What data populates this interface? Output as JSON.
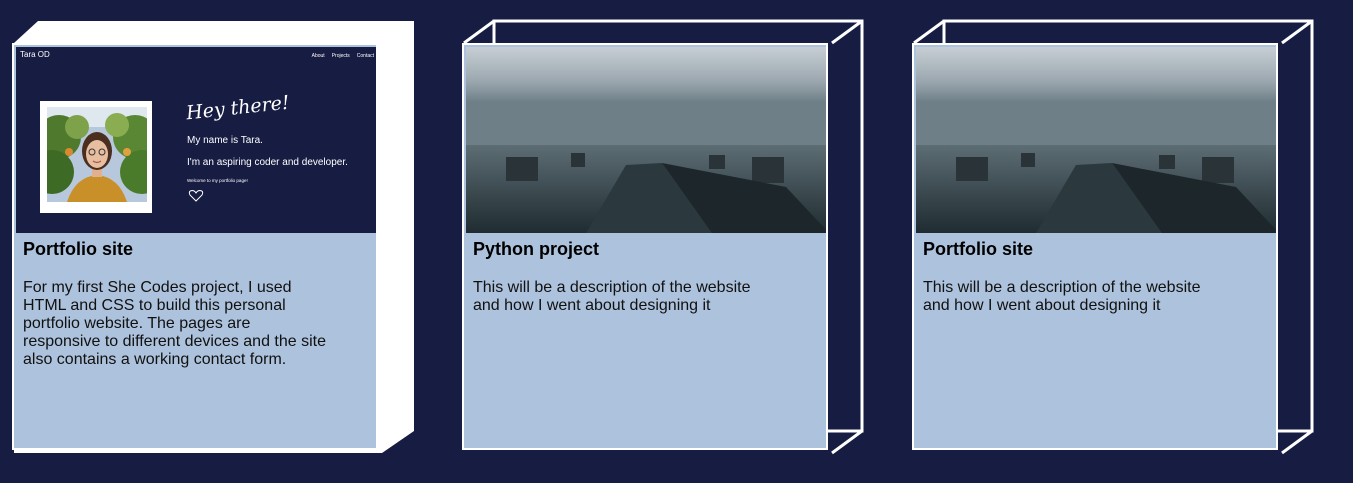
{
  "cards": [
    {
      "title": "Portfolio site",
      "description": "For my first She Codes project, I used HTML and CSS to build this personal portfolio website. The pages are responsive to different devices and the site also contains a working contact form.",
      "thumbnail": "portfolio-preview",
      "preview": {
        "brand": "Tara OD",
        "nav": [
          "About",
          "Projects",
          "Contact"
        ],
        "greeting": "Hey there!",
        "line1": "My name is Tara.",
        "line2": "I'm an aspiring coder and developer.",
        "line3": "Welcome to my portfolio page!"
      }
    },
    {
      "title": "Python project",
      "description": "This will be a description of the website and how I went about designing it",
      "thumbnail": "pier-photo"
    },
    {
      "title": "Portfolio site",
      "description": "This will be a description of the website and how I went about designing it",
      "thumbnail": "pier-photo"
    }
  ],
  "colors": {
    "background": "#171c42",
    "card_body": "#adc2dc",
    "outline": "#ffffff"
  }
}
